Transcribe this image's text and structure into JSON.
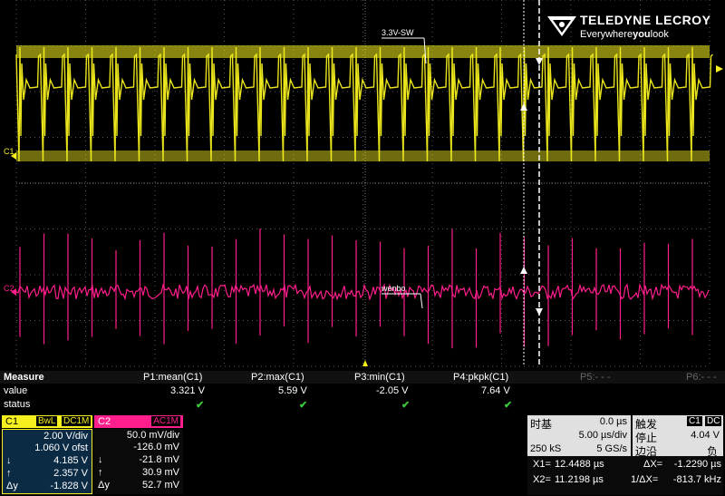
{
  "screen": {
    "brand": "TELEDYNE LECROY",
    "tagline_pre": "Everywhere",
    "tagline_bold": "you",
    "tagline_post": "look",
    "ch1_marker": "C1",
    "ch2_marker": "C2",
    "trace1_label": "3.3V-SW",
    "trace2_label": "wenbo",
    "colors": {
      "ch1": "#f5f01e",
      "ch2": "#ff1e8c",
      "grid": "#555555"
    }
  },
  "measure": {
    "header_label": "Measure",
    "value_label": "value",
    "status_label": "status",
    "params": [
      {
        "name": "P1:mean(C1)",
        "value": "3.321 V",
        "status": "✔"
      },
      {
        "name": "P2:max(C1)",
        "value": "5.59 V",
        "status": "✔"
      },
      {
        "name": "P3:min(C1)",
        "value": "-2.05 V",
        "status": "✔"
      },
      {
        "name": "P4:pkpk(C1)",
        "value": "7.64 V",
        "status": "✔"
      },
      {
        "name": "P5:- - -",
        "value": "",
        "status": ""
      },
      {
        "name": "P6:- - -",
        "value": "",
        "status": ""
      }
    ]
  },
  "ch1": {
    "name": "C1",
    "tag1": "BwL",
    "tag2": "DC1M",
    "vdiv": "2.00 V/div",
    "offset": "1.060 V ofst",
    "down_sym": "↓",
    "down": "4.185 V",
    "up_sym": "↑",
    "up": "2.357 V",
    "dy_sym": "Δy",
    "dy": "-1.828 V"
  },
  "ch2": {
    "name": "C2",
    "tag": "AC1M",
    "vdiv": "50.0 mV/div",
    "offset": "-126.0 mV",
    "down_sym": "↓",
    "down": "-21.8 mV",
    "up_sym": "↑",
    "up": "30.9 mV",
    "dy_sym": "Δy",
    "dy": "52.7 mV"
  },
  "timebase": {
    "title": "时基",
    "delay": "0.0 µs",
    "tdiv": "5.00 µs/div",
    "samples": "250 kS",
    "rate": "5 GS/s",
    "x1_label": "X1=",
    "x1": "12.4488 µs",
    "x2_label": "X2=",
    "x2": "11.2198 µs",
    "dx_label": "ΔX=",
    "dx": "-1.2290 µs",
    "inv_dx_label": "1/ΔX=",
    "inv_dx": "-813.7 kHz"
  },
  "trigger": {
    "title": "触发",
    "ch": "C1",
    "coupling": "DC",
    "mode": "停止",
    "level": "4.04 V",
    "edge": "边沿",
    "slope": "负"
  }
}
